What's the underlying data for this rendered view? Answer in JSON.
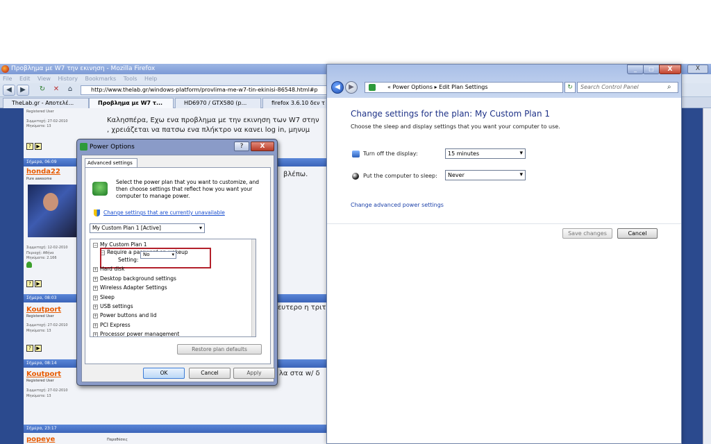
{
  "firefox": {
    "title": "Προβλημα με W7 την εκινηση - Mozilla Firefox",
    "close_label": "X",
    "menu": [
      "File",
      "Edit",
      "View",
      "History",
      "Bookmarks",
      "Tools",
      "Help"
    ],
    "url": "http://www.thelab.gr/windows-platform/provlima-me-w7-tin-ekinisi-86548.html#p",
    "tabs": [
      "TheLab.gr - Αποτελέ...",
      "Προβλημα με W7 τ...",
      "HD6970 / GTX580 (p...",
      "firefox 3.6.10 δεν τ"
    ],
    "forum": {
      "post0_meta1": "Registered User",
      "post0_meta2": "Συμμετοχή: 27-02-2010",
      "post0_meta3": "Μηνύματα: 13",
      "post0_text1": "Καλησπέρα, Εχω ενα προβλημα με την εκινηση των W7 στην",
      "post0_text2": ", χρειάζεται να πατσω ενα πλήκτρο να κανει log in, μηνυμ",
      "row1": "Σήμερα, 06:09",
      "user1": "honda22",
      "role1": "Pure awesome",
      "meta1a": "Συμμετοχή: 12-02-2010",
      "meta1b": "Περιοχή: Αθήνα",
      "meta1c": "Μηνύματα: 2.166",
      "text1": "βλέπω.",
      "row2": "Σήμερα, 08:03",
      "user2": "Koutport",
      "role2": "Registered User",
      "meta2a": "Συμμετοχή: 27-02-2010",
      "meta2b": "Μηνύματα: 13",
      "text2": "ευτερο η τριτ",
      "row3": "Σήμερα, 08:14",
      "user3": "Koutport",
      "role3": "Registered User",
      "meta3a": "Συμμετοχή: 27-02-2010",
      "meta3b": "Μηνύματα: 13",
      "text3": "λα στα w/ δ",
      "row4": "Σήμερα, 23:17",
      "user4": "popeye",
      "role4": "Παραθέσεις"
    }
  },
  "dialog": {
    "title": "Power Options",
    "help": "?",
    "close": "X",
    "tab": "Advanced settings",
    "desc": "Select the power plan that you want to customize, and then choose settings that reflect how you want your computer to manage power.",
    "link": "Change settings that are currently unavailable",
    "plan": "My Custom Plan 1 [Active]",
    "tree": [
      {
        "pm": "−",
        "label": "My Custom Plan 1"
      },
      {
        "pm": "−",
        "label": "Require a password on wakeup"
      },
      {
        "pm": "+",
        "label": "Hard disk"
      },
      {
        "pm": "+",
        "label": "Desktop background settings"
      },
      {
        "pm": "+",
        "label": "Wireless Adapter Settings"
      },
      {
        "pm": "+",
        "label": "Sleep"
      },
      {
        "pm": "+",
        "label": "USB settings"
      },
      {
        "pm": "+",
        "label": "Power buttons and lid"
      },
      {
        "pm": "+",
        "label": "PCI Express"
      },
      {
        "pm": "+",
        "label": "Processor power management"
      }
    ],
    "setting_label": "Setting:",
    "setting_value": "No",
    "restore": "Restore plan defaults",
    "ok": "OK",
    "cancel": "Cancel",
    "apply": "Apply"
  },
  "control_panel": {
    "min": "_",
    "max": "□",
    "close": "X",
    "breadcrumb": "« Power Options ▸ Edit Plan Settings",
    "search_placeholder": "Search Control Panel",
    "heading": "Change settings for the plan: My Custom Plan 1",
    "subheading": "Choose the sleep and display settings that you want your computer to use.",
    "display_label": "Turn off the display:",
    "display_value": "15 minutes",
    "sleep_label": "Put the computer to sleep:",
    "sleep_value": "Never",
    "advanced_link": "Change advanced power settings",
    "save": "Save changes",
    "cancel": "Cancel"
  }
}
